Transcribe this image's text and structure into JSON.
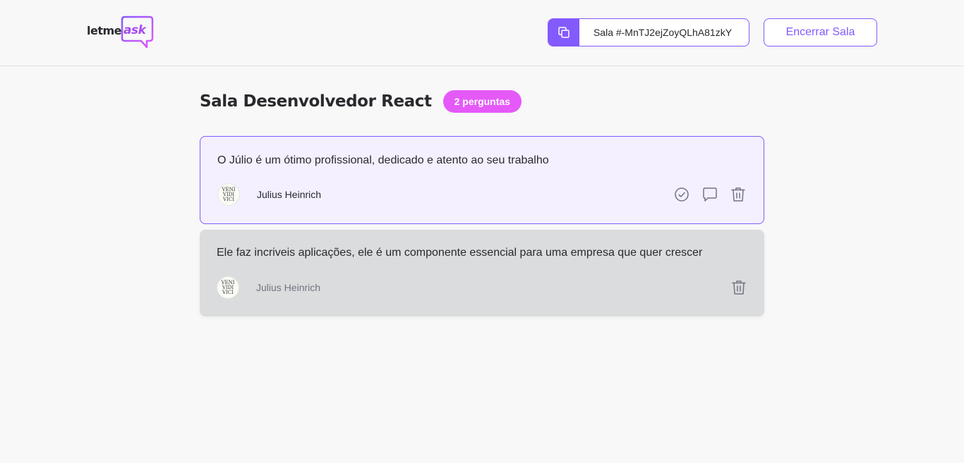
{
  "header": {
    "logo": {
      "text_main": "letme",
      "text_accent": "ask"
    },
    "room_code": {
      "label": "Sala #-MnTJ2ejZoyQLhA81zkY",
      "copy_icon": "copy-icon"
    },
    "close_room_label": "Encerrar Sala"
  },
  "main": {
    "title": "Sala Desenvolvedor React",
    "question_count_label": "2 perguntas",
    "questions": [
      {
        "content": "O Júlio é um ótimo profissional, dedicado e atento ao seu trabalho",
        "author": "Julius Heinrich",
        "avatar_text": [
          "VENI",
          "VIDI",
          "VICI"
        ],
        "highlighted": true,
        "answered": false,
        "actions": [
          "check-circle-icon",
          "answer-icon",
          "trash-icon"
        ]
      },
      {
        "content": "Ele faz incriveis aplicações, ele é um componente essencial para uma empresa que quer crescer",
        "author": "Julius Heinrich",
        "avatar_text": [
          "VENI",
          "VIDI",
          "VICI"
        ],
        "highlighted": false,
        "answered": true,
        "actions": [
          "trash-icon"
        ]
      }
    ]
  },
  "colors": {
    "primary": "#835afd",
    "accent_pink": "#e559f9",
    "background": "#f8f8f8",
    "highlight_bg": "#f4f0ff",
    "answered_bg": "#dbdcdd",
    "icon_gray": "#737380"
  }
}
